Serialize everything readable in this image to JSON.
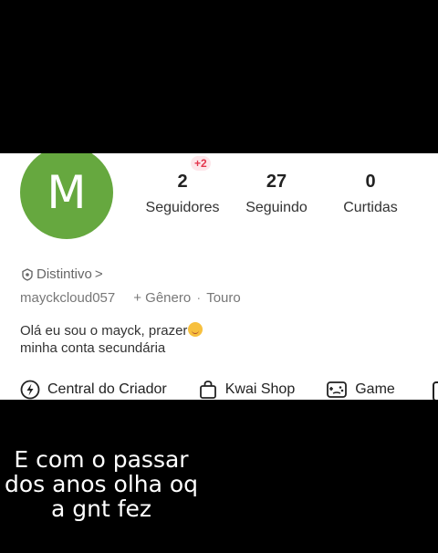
{
  "profile": {
    "avatar_letter": "M",
    "avatar_color": "#66a83f",
    "stats": [
      {
        "value": "2",
        "label": "Seguidores",
        "badge": "+2"
      },
      {
        "value": "27",
        "label": "Seguindo"
      },
      {
        "value": "0",
        "label": "Curtidas"
      }
    ],
    "distintivo_label": "Distintivo",
    "distintivo_chevron": ">",
    "username": "mayckcloud057",
    "gender_action": "+ Gênero",
    "separator": "·",
    "zodiac": "Touro",
    "bio_line1": "Olá eu sou o mayck, prazer",
    "bio_line2": "minha conta secundária",
    "shortcuts": [
      {
        "label": "Central do Criador",
        "icon": "lightning-circle-icon"
      },
      {
        "label": "Kwai Shop",
        "icon": "shopping-bag-icon"
      },
      {
        "label": "Game",
        "icon": "gamepad-icon"
      }
    ]
  },
  "caption": {
    "line1": "E com o passar",
    "line2": "dos anos olha oq",
    "line3": "a gnt fez"
  }
}
